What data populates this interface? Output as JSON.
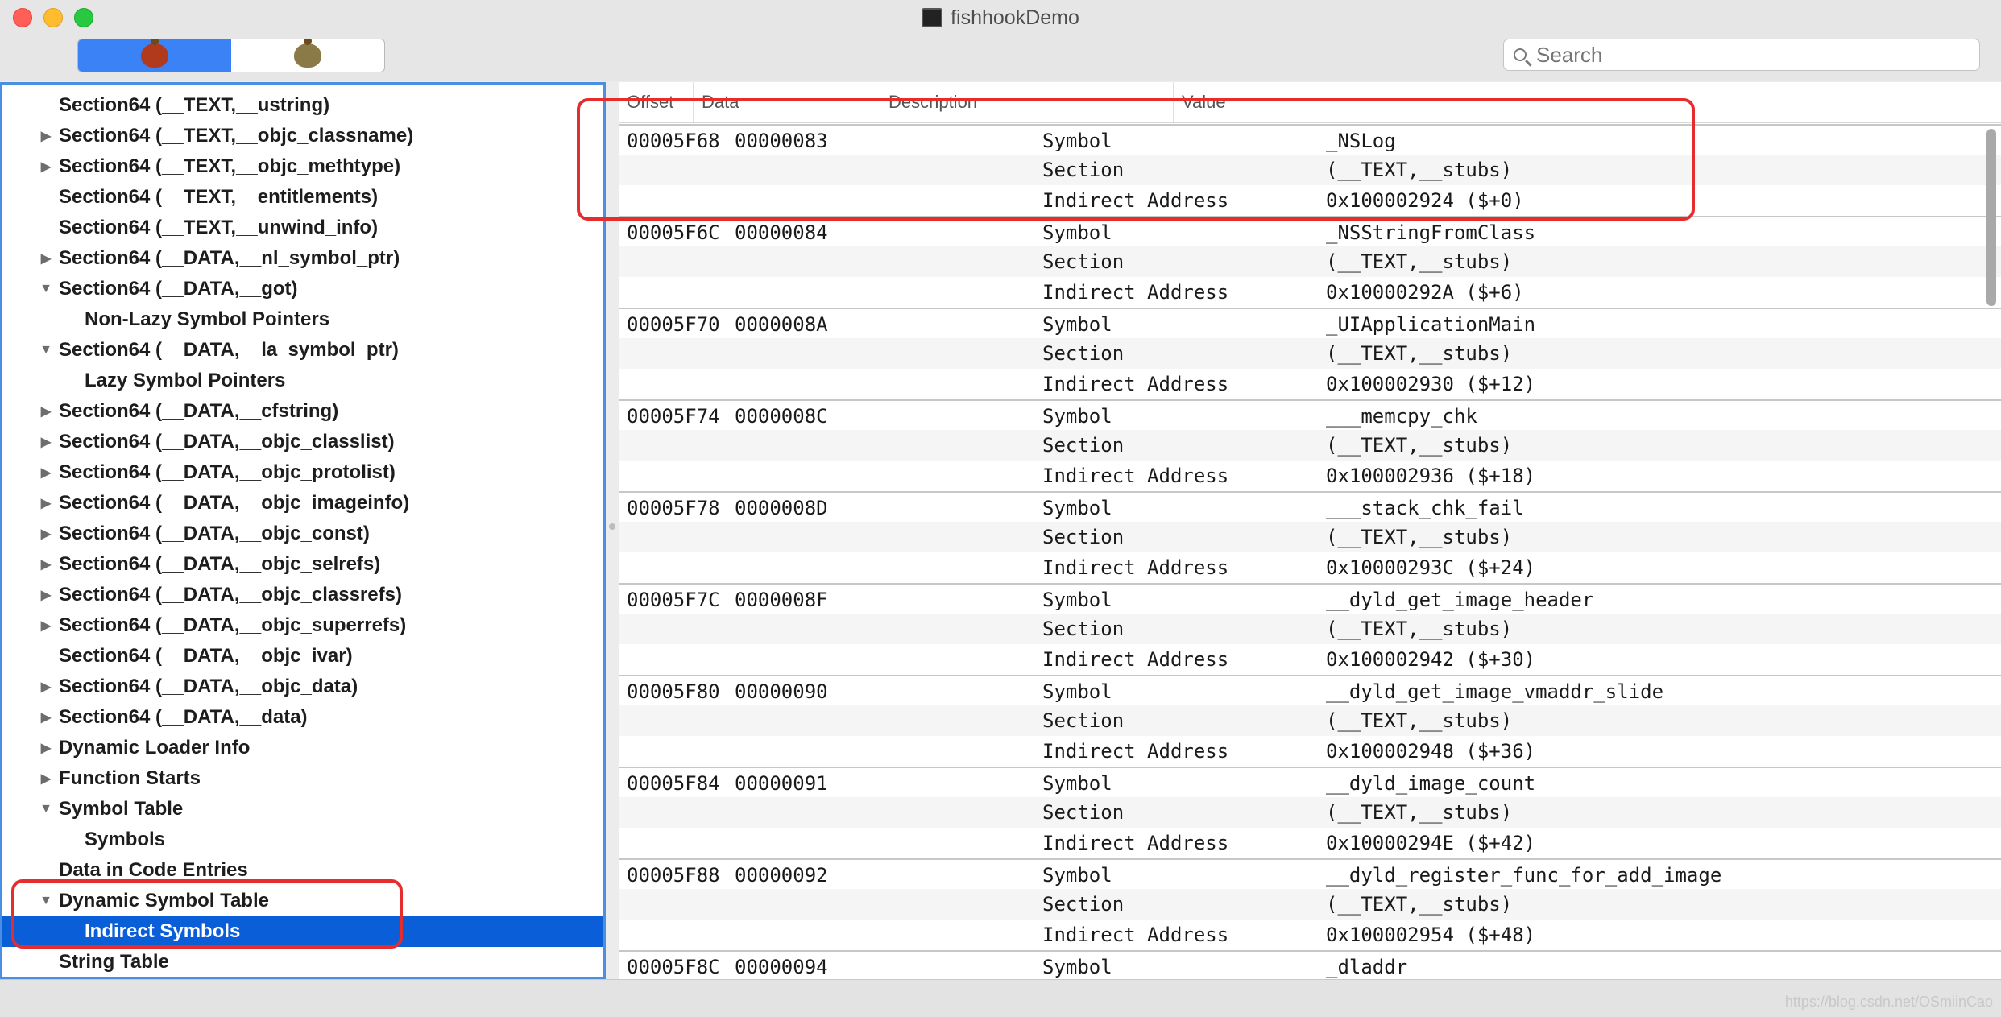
{
  "window": {
    "title": "fishhookDemo"
  },
  "search": {
    "placeholder": "Search"
  },
  "colors": {
    "selection": "#0a5fd9",
    "annotation": "#e52d2d",
    "sidebar_border": "#4a90e2"
  },
  "sidebar": {
    "items": [
      {
        "label": "Section64 (__TEXT,__ustring)",
        "level": 0,
        "disclosure": ""
      },
      {
        "label": "Section64 (__TEXT,__objc_classname)",
        "level": 0,
        "disclosure": "collapsed"
      },
      {
        "label": "Section64 (__TEXT,__objc_methtype)",
        "level": 0,
        "disclosure": "collapsed"
      },
      {
        "label": "Section64 (__TEXT,__entitlements)",
        "level": 0,
        "disclosure": ""
      },
      {
        "label": "Section64 (__TEXT,__unwind_info)",
        "level": 0,
        "disclosure": ""
      },
      {
        "label": "Section64 (__DATA,__nl_symbol_ptr)",
        "level": 0,
        "disclosure": "collapsed"
      },
      {
        "label": "Section64 (__DATA,__got)",
        "level": 0,
        "disclosure": "expanded"
      },
      {
        "label": "Non-Lazy Symbol Pointers",
        "level": 1,
        "disclosure": ""
      },
      {
        "label": "Section64 (__DATA,__la_symbol_ptr)",
        "level": 0,
        "disclosure": "expanded"
      },
      {
        "label": "Lazy Symbol Pointers",
        "level": 1,
        "disclosure": ""
      },
      {
        "label": "Section64 (__DATA,__cfstring)",
        "level": 0,
        "disclosure": "collapsed"
      },
      {
        "label": "Section64 (__DATA,__objc_classlist)",
        "level": 0,
        "disclosure": "collapsed"
      },
      {
        "label": "Section64 (__DATA,__objc_protolist)",
        "level": 0,
        "disclosure": "collapsed"
      },
      {
        "label": "Section64 (__DATA,__objc_imageinfo)",
        "level": 0,
        "disclosure": "collapsed"
      },
      {
        "label": "Section64 (__DATA,__objc_const)",
        "level": 0,
        "disclosure": "collapsed"
      },
      {
        "label": "Section64 (__DATA,__objc_selrefs)",
        "level": 0,
        "disclosure": "collapsed"
      },
      {
        "label": "Section64 (__DATA,__objc_classrefs)",
        "level": 0,
        "disclosure": "collapsed"
      },
      {
        "label": "Section64 (__DATA,__objc_superrefs)",
        "level": 0,
        "disclosure": "collapsed"
      },
      {
        "label": "Section64 (__DATA,__objc_ivar)",
        "level": 0,
        "disclosure": ""
      },
      {
        "label": "Section64 (__DATA,__objc_data)",
        "level": 0,
        "disclosure": "collapsed"
      },
      {
        "label": "Section64 (__DATA,__data)",
        "level": 0,
        "disclosure": "collapsed"
      },
      {
        "label": "Dynamic Loader Info",
        "level": 0,
        "disclosure": "collapsed"
      },
      {
        "label": "Function Starts",
        "level": 0,
        "disclosure": "collapsed"
      },
      {
        "label": "Symbol Table",
        "level": 0,
        "disclosure": "expanded"
      },
      {
        "label": "Symbols",
        "level": 1,
        "disclosure": ""
      },
      {
        "label": "Data in Code Entries",
        "level": 0,
        "disclosure": ""
      },
      {
        "label": "Dynamic Symbol Table",
        "level": 0,
        "disclosure": "expanded"
      },
      {
        "label": "Indirect Symbols",
        "level": 1,
        "disclosure": "",
        "selected": true
      },
      {
        "label": "String Table",
        "level": 0,
        "disclosure": ""
      }
    ]
  },
  "table": {
    "columns": [
      "Offset",
      "Data",
      "Description",
      "Value"
    ],
    "entries": [
      {
        "offset": "00005F68",
        "data": "00000083",
        "symbol": "_NSLog",
        "section": "(__TEXT,__stubs)",
        "indirect": "0x100002924 ($+0)"
      },
      {
        "offset": "00005F6C",
        "data": "00000084",
        "symbol": "_NSStringFromClass",
        "section": "(__TEXT,__stubs)",
        "indirect": "0x10000292A ($+6)"
      },
      {
        "offset": "00005F70",
        "data": "0000008A",
        "symbol": "_UIApplicationMain",
        "section": "(__TEXT,__stubs)",
        "indirect": "0x100002930 ($+12)"
      },
      {
        "offset": "00005F74",
        "data": "0000008C",
        "symbol": "___memcpy_chk",
        "section": "(__TEXT,__stubs)",
        "indirect": "0x100002936 ($+18)"
      },
      {
        "offset": "00005F78",
        "data": "0000008D",
        "symbol": "___stack_chk_fail",
        "section": "(__TEXT,__stubs)",
        "indirect": "0x10000293C ($+24)"
      },
      {
        "offset": "00005F7C",
        "data": "0000008F",
        "symbol": "__dyld_get_image_header",
        "section": "(__TEXT,__stubs)",
        "indirect": "0x100002942 ($+30)"
      },
      {
        "offset": "00005F80",
        "data": "00000090",
        "symbol": "__dyld_get_image_vmaddr_slide",
        "section": "(__TEXT,__stubs)",
        "indirect": "0x100002948 ($+36)"
      },
      {
        "offset": "00005F84",
        "data": "00000091",
        "symbol": "__dyld_image_count",
        "section": "(__TEXT,__stubs)",
        "indirect": "0x10000294E ($+42)"
      },
      {
        "offset": "00005F88",
        "data": "00000092",
        "symbol": "__dyld_register_func_for_add_image",
        "section": "(__TEXT,__stubs)",
        "indirect": "0x100002954 ($+48)"
      },
      {
        "offset": "00005F8C",
        "data": "00000094",
        "symbol": "_dladdr",
        "section": "",
        "indirect": ""
      }
    ],
    "labels": {
      "symbol": "Symbol",
      "section": "Section",
      "indirect": "Indirect Address"
    }
  },
  "watermark": "https://blog.csdn.net/OSmiinCao"
}
